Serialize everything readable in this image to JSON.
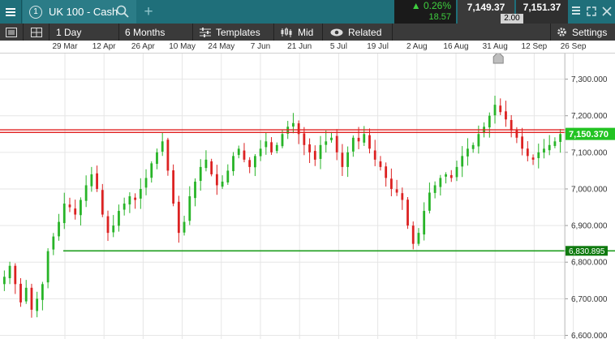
{
  "window": {
    "instrument_number": "1",
    "instrument_name": "UK 100 - Cash",
    "change_percent": "0.26%",
    "change_points": "18.57",
    "sell_price": "7,149.37",
    "buy_price": "7,151.37",
    "spread": "2.00"
  },
  "toolbar": {
    "interval": "1 Day",
    "range": "6 Months",
    "templates": "Templates",
    "price_type": "Mid",
    "related": "Related",
    "settings": "Settings"
  },
  "colors": {
    "up": "#28b428",
    "down": "#dc2222",
    "resistance": "#e02020",
    "support": "#1e9e1e",
    "grid": "#e6e6e6"
  },
  "chart_data": {
    "type": "candlestick",
    "x_ticks": [
      "29 Mar",
      "12 Apr",
      "26 Apr",
      "10 May",
      "24 May",
      "7 Jun",
      "21 Jun",
      "5 Jul",
      "19 Jul",
      "2 Aug",
      "16 Aug",
      "31 Aug",
      "12 Sep",
      "26 Sep"
    ],
    "y_ticks": [
      "7,300.000",
      "7,200.000",
      "7,100.000",
      "7,000.000",
      "6,900.000",
      "6,800.000",
      "6,700.000",
      "6,600.000"
    ],
    "y_tick_values": [
      7300,
      7200,
      7100,
      7000,
      6900,
      6800,
      6700,
      6600
    ],
    "ylim": [
      6590,
      7370
    ],
    "current_price": "7,150.370",
    "current_price_value": 7150.37,
    "support_label": "6,830.895",
    "support_value": 6830.895,
    "resistance_value": 7158,
    "closes": [
      6760,
      6790,
      6740,
      6690,
      6730,
      6670,
      6700,
      6740,
      6830,
      6870,
      6910,
      6960,
      6950,
      6930,
      6970,
      7010,
      7040,
      7000,
      6930,
      6880,
      6900,
      6940,
      6960,
      6980,
      6970,
      7000,
      7030,
      7070,
      7100,
      7130,
      7050,
      6960,
      6880,
      6910,
      6980,
      7020,
      7060,
      7080,
      7040,
      7010,
      7020,
      7050,
      7090,
      7110,
      7080,
      7060,
      7090,
      7110,
      7130,
      7100,
      7120,
      7150,
      7170,
      7180,
      7150,
      7120,
      7100,
      7080,
      7120,
      7130,
      7140,
      7100,
      7060,
      7100,
      7140,
      7130,
      7150,
      7110,
      7080,
      7060,
      7030,
      7000,
      6990,
      6970,
      6900,
      6850,
      6880,
      6940,
      6990,
      7010,
      7030,
      7040,
      7030,
      7060,
      7090,
      7110,
      7120,
      7150,
      7170,
      7200,
      7230,
      7210,
      7190,
      7160,
      7140,
      7110,
      7090,
      7080,
      7100,
      7110,
      7120,
      7130,
      7150
    ],
    "resistance_label": ""
  }
}
